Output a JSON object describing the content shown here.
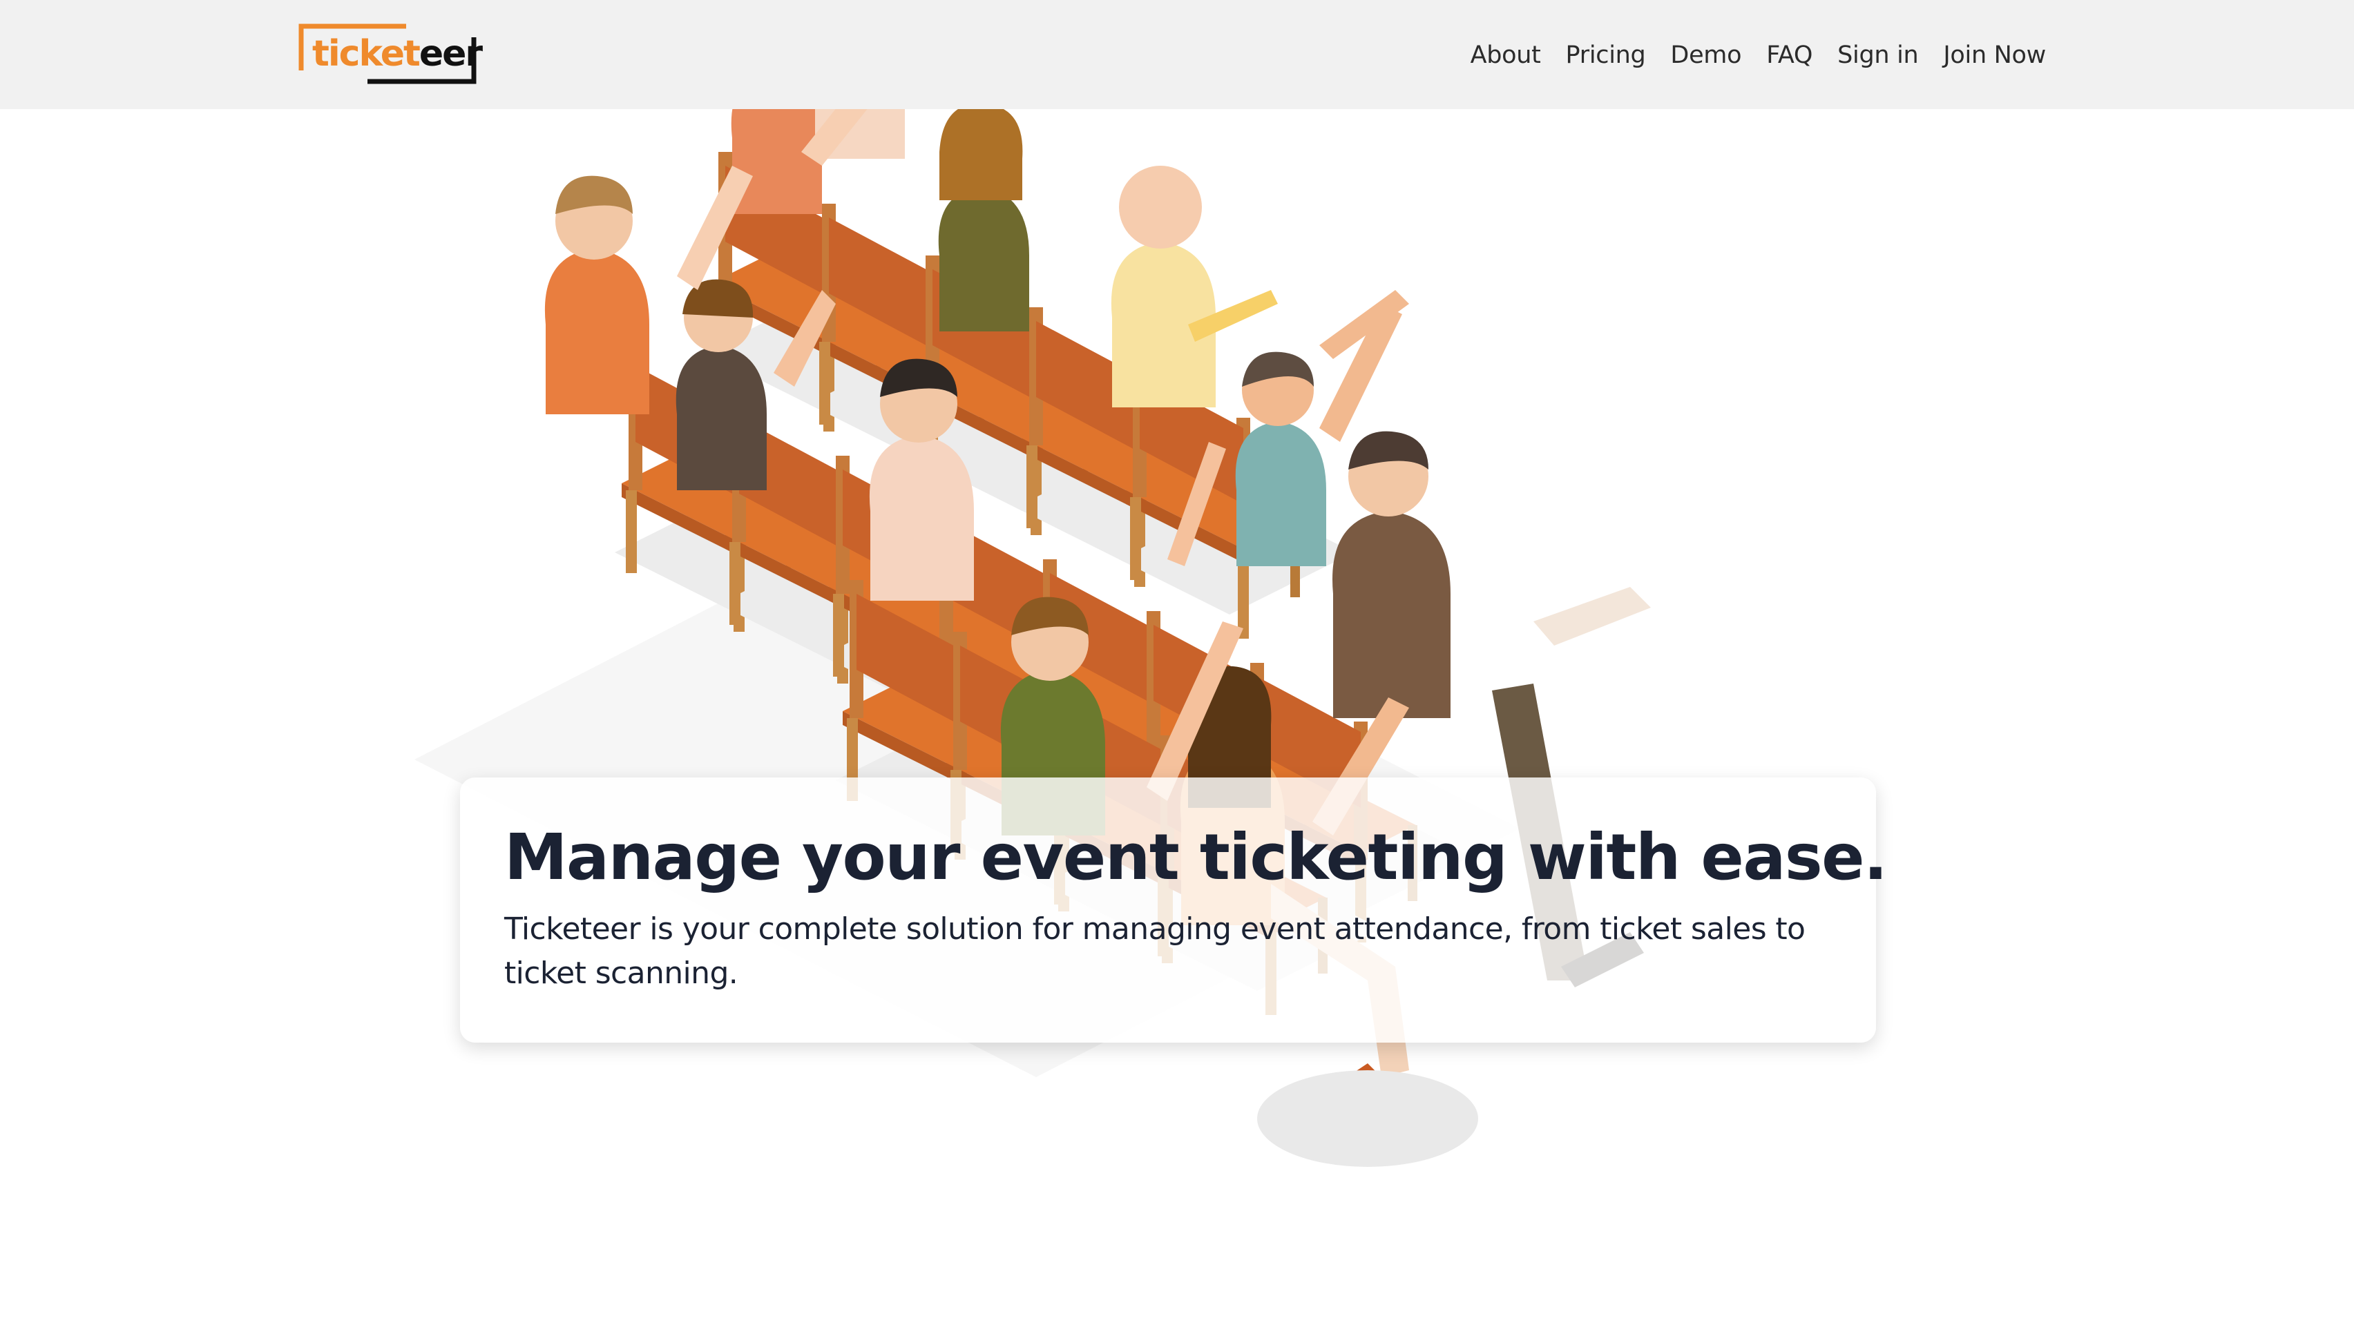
{
  "brand": {
    "logo_part_a": "ticket",
    "logo_part_b": "eer",
    "accent_color": "#ef8a2c",
    "dark_color": "#111111"
  },
  "nav": {
    "items": [
      {
        "label": "About"
      },
      {
        "label": "Pricing"
      },
      {
        "label": "Demo"
      },
      {
        "label": "FAQ"
      },
      {
        "label": "Sign in"
      },
      {
        "label": "Join Now"
      }
    ]
  },
  "hero": {
    "title": "Manage your event ticketing with ease.",
    "subtitle": "Ticketeer is your complete solution for managing event attendance, from ticket sales to ticket scanning.",
    "illustration": "audience-seated-raising-hands-illustration"
  },
  "colors": {
    "header_bg": "#f1f1f1",
    "chair_wood": "#c96a2a",
    "chair_seat": "#e0742c",
    "text_dark": "#1b2233"
  }
}
